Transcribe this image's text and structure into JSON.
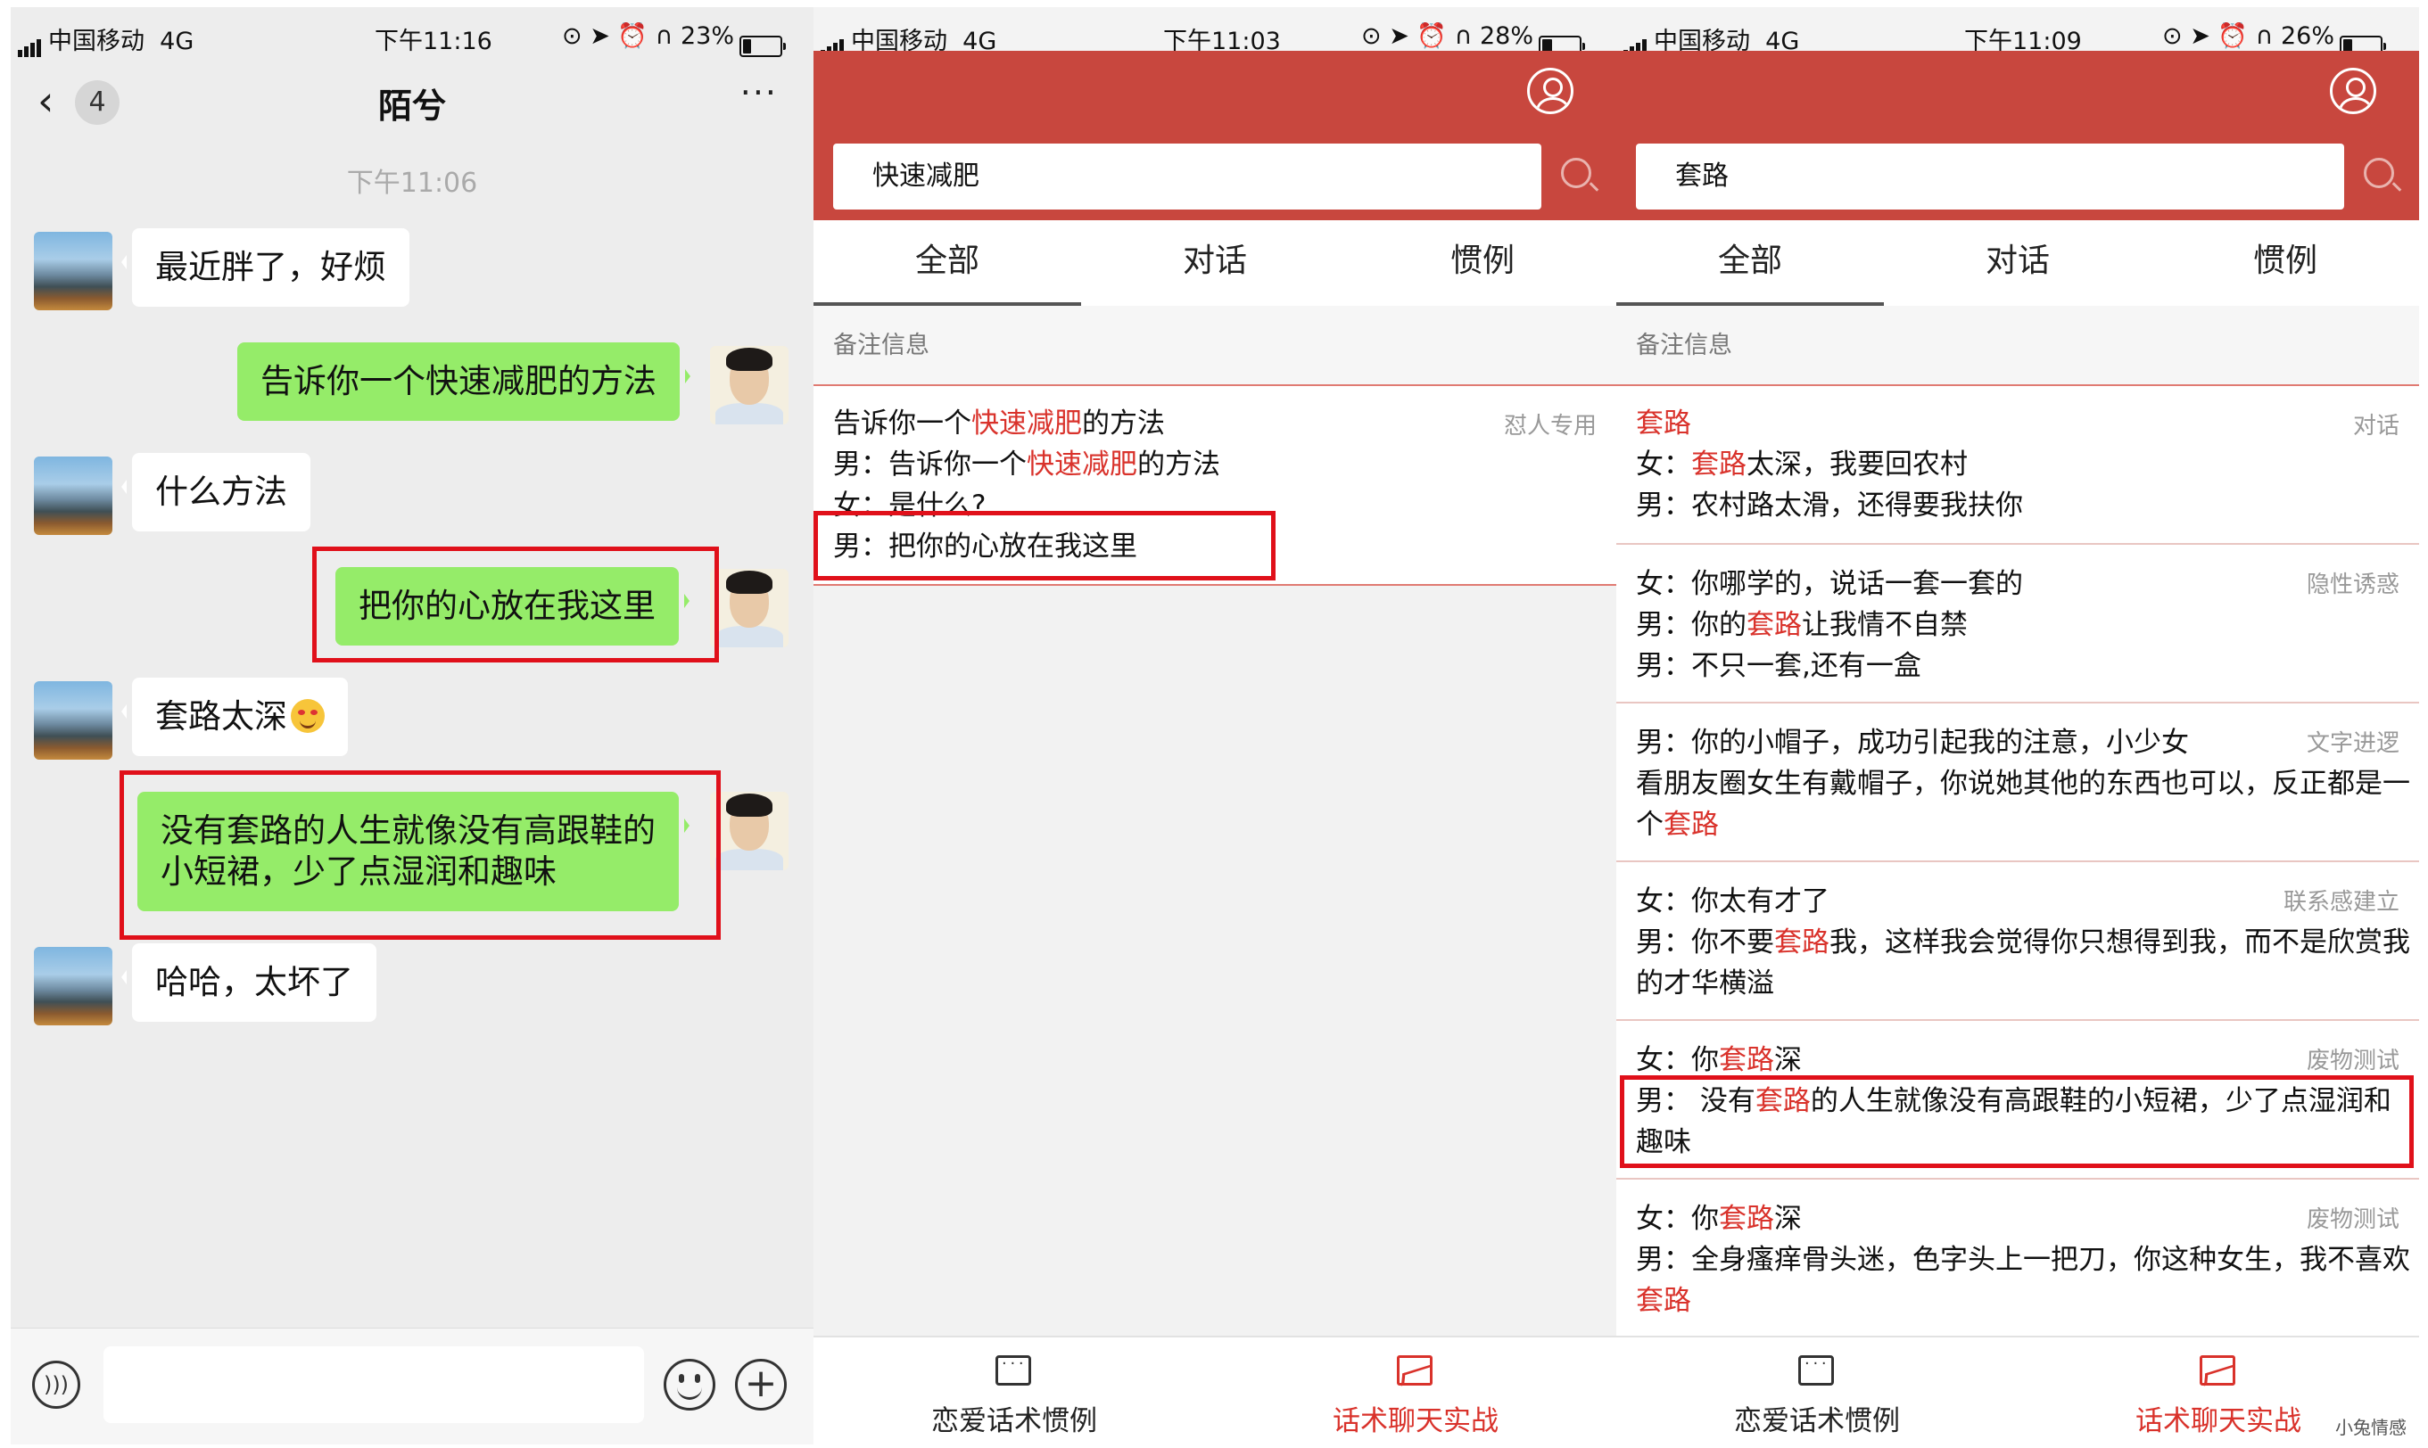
{
  "p1": {
    "status": {
      "carrier": "中国移动",
      "net": "4G",
      "time": "下午11:16",
      "battery": "23%",
      "battery_level": 0.23
    },
    "header": {
      "back_count": "4",
      "title": "陌兮",
      "more": "···"
    },
    "timestamp": "下午11:06",
    "messages": [
      {
        "side": "left",
        "text": "最近胖了，好烦"
      },
      {
        "side": "right",
        "text": "告诉你一个快速减肥的方法"
      },
      {
        "side": "left",
        "text": "什么方法"
      },
      {
        "side": "right",
        "text": "把你的心放在我这里"
      },
      {
        "side": "left",
        "text": "套路太深",
        "emoji": "heart-eyes-emoji"
      },
      {
        "side": "right",
        "text": "没有套路的人生就像没有高跟鞋的",
        "text2": "小短裙，少了点湿润和趣味"
      },
      {
        "side": "left",
        "text": "哈哈，太坏了"
      }
    ],
    "input_icons": {
      "voice": "voice-icon",
      "emoji": "emoji-icon",
      "plus": "plus-icon"
    }
  },
  "p2": {
    "status": {
      "carrier": "中国移动",
      "net": "4G",
      "time": "下午11:03",
      "battery": "28%",
      "battery_level": 0.28
    },
    "search": {
      "value": "快速减肥"
    },
    "tabs": [
      "全部",
      "对话",
      "惯例"
    ],
    "section": "备注信息",
    "card": {
      "tag": "怼人专用",
      "lines": [
        {
          "a": "告诉你一个",
          "h": "快速减肥",
          "b": "的方法"
        },
        {
          "a": "男：告诉你一个",
          "h": "快速减肥",
          "b": "的方法"
        },
        {
          "a": "女：是什么?",
          "h": "",
          "b": ""
        },
        {
          "a": "男：把你的心放在我这里",
          "h": "",
          "b": ""
        }
      ]
    },
    "nav": [
      "恋爱话术惯例",
      "话术聊天实战"
    ]
  },
  "p3": {
    "status": {
      "carrier": "中国移动",
      "net": "4G",
      "time": "下午11:09",
      "battery": "26%",
      "battery_level": 0.26
    },
    "search": {
      "value": "套路"
    },
    "tabs": [
      "全部",
      "对话",
      "惯例"
    ],
    "section": "备注信息",
    "cards": [
      {
        "tag": "对话",
        "lines": [
          {
            "a": "",
            "h": "套路",
            "b": ""
          },
          {
            "a": "女：",
            "h": "套路",
            "b": "太深，我要回农村"
          },
          {
            "a": "男：农村路太滑，还得要我扶你",
            "h": "",
            "b": ""
          }
        ]
      },
      {
        "tag": "隐性诱惑",
        "lines": [
          {
            "a": "女：你哪学的，说话一套一套的",
            "h": "",
            "b": ""
          },
          {
            "a": "男：你的",
            "h": "套路",
            "b": "让我情不自禁"
          },
          {
            "a": "男：不只一套,还有一盒",
            "h": "",
            "b": ""
          }
        ]
      },
      {
        "tag": "文字进逻",
        "lines": [
          {
            "a": "男：你的小帽子，成功引起我的注意，小少女",
            "h": "",
            "b": ""
          },
          {
            "a": "看朋友圈女生有戴帽子，你说她其他的东西也可以，反正都是一",
            "h": "",
            "b": ""
          },
          {
            "a": "个",
            "h": "套路",
            "b": ""
          }
        ]
      },
      {
        "tag": "联系感建立",
        "lines": [
          {
            "a": "女：你太有才了",
            "h": "",
            "b": ""
          },
          {
            "a": "男：你不要",
            "h": "套路",
            "b": "我，这样我会觉得你只想得到我，而不是欣赏我"
          },
          {
            "a": "的才华横溢",
            "h": "",
            "b": ""
          }
        ]
      },
      {
        "tag": "废物测试",
        "lines": [
          {
            "a": "女：你",
            "h": "套路",
            "b": "深"
          },
          {
            "a": "男： 没有",
            "h": "套路",
            "b": "的人生就像没有高跟鞋的小短裙，少了点湿润和"
          },
          {
            "a": "趣味",
            "h": "",
            "b": ""
          }
        ]
      },
      {
        "tag": "废物测试",
        "lines": [
          {
            "a": "女：你",
            "h": "套路",
            "b": "深"
          },
          {
            "a": "男：全身瘙痒骨头迷，色字头上一把刀，你这种女生，我不喜欢",
            "h": "",
            "b": ""
          },
          {
            "a": "",
            "h": "套路",
            "b": ""
          }
        ]
      }
    ],
    "nav": [
      "恋爱话术惯例",
      "话术聊天实战"
    ],
    "watermark": "小兔情感"
  },
  "colors": {
    "brand_red": "#c8473e",
    "highlight": "#d9322b",
    "bubble_green": "#95ec69",
    "annotation_red": "#e0101a"
  }
}
